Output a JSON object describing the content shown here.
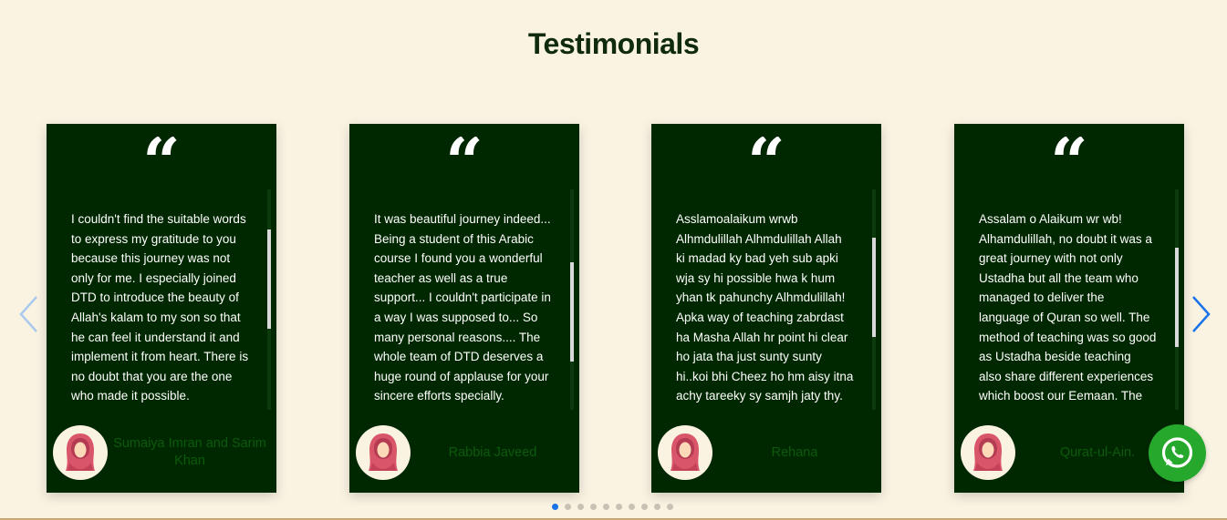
{
  "section": {
    "title": "Testimonials"
  },
  "colors": {
    "background": "#fbf3e2",
    "card": "#002800",
    "accent": "#1a73e8",
    "name_text": "#0c5a0c",
    "whatsapp": "#25a82b"
  },
  "quote_glyph": "“",
  "testimonials": [
    {
      "text": "I couldn't find the suitable words to express my gratitude to you because this journey was not only for me. I especially joined DTD to introduce the beauty of Allah's kalam to my son so that he can feel it understand it and implement it from heart. There is no doubt that you are the one who made it possible.",
      "name": "Sumaiya Imran and Sarim Khan",
      "scroll_fraction": 0.33
    },
    {
      "text": "It was beautiful journey indeed... Being a student of this Arabic course I found you a wonderful teacher as well as a true support... I couldn't participate in a way I was supposed to... So many personal reasons.... The whole team of DTD deserves a huge round of applause for your sincere efforts specially.",
      "name": "Rabbia Javeed",
      "scroll_fraction": 0.6
    },
    {
      "text": "Asslamoalaikum wrwb Alhmdulillah Alhmdulillah Allah ki madad ky bad yeh sub apki wja sy hi possible hwa k hum yhan tk pahunchy Alhmdulillah! Apka way of teaching zabrdast ha Masha Allah hr point hi clear ho jata tha just sunty sunty hi..koi bhi Cheez ho hm aisy itna achy tareeky sy samjh jaty thy.",
      "name": "Rehana",
      "scroll_fraction": 0.4
    },
    {
      "text": "Assalam o Alaikum wr wb! Alhamdulillah, no doubt it was a great journey with not only Ustadha but all the team who managed to deliver the language of Quran so well. The method of teaching was so good as Ustadha beside teaching also share different experiences which boost our Eemaan. The efforts and love.",
      "name": "Qurat-ul-Ain.",
      "scroll_fraction": 0.48
    }
  ],
  "carousel": {
    "total_slides": 10,
    "active_slide": 1,
    "prev_icon": "chevron-left-icon",
    "next_icon": "chevron-right-icon"
  },
  "whatsapp": {
    "icon": "whatsapp-icon"
  }
}
